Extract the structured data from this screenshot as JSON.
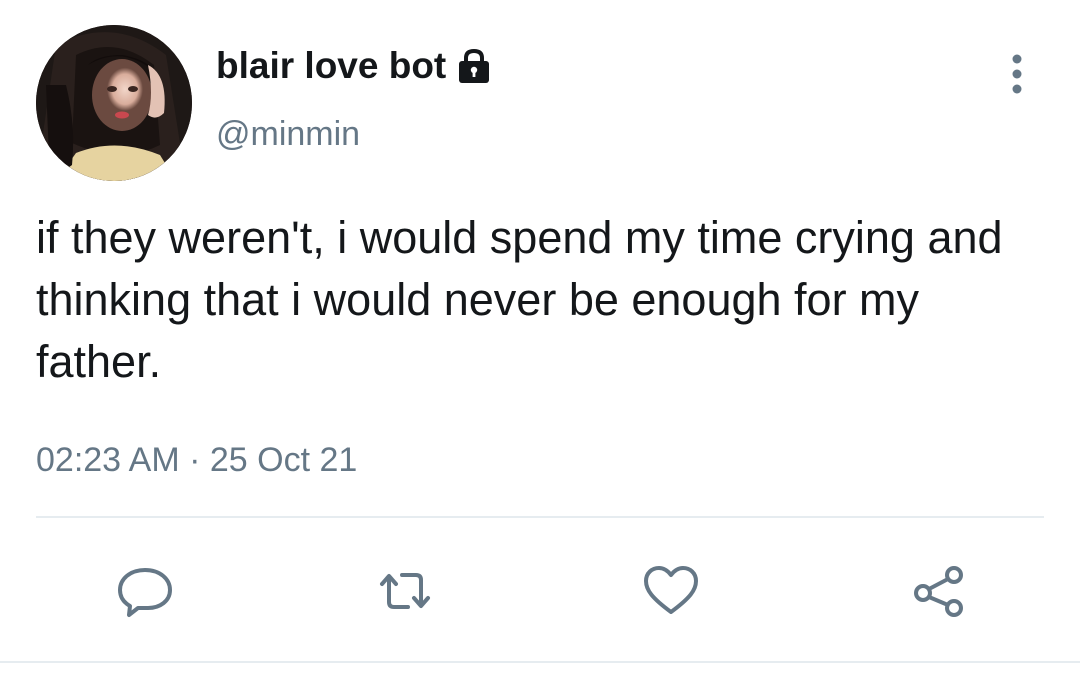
{
  "tweet": {
    "author": {
      "display_name": "blair love bot",
      "handle": "@minmin",
      "avatar_icon": "profile-photo",
      "protected_icon": "lock-icon"
    },
    "text": "if they weren't, i would spend my time crying and thinking that i would never be enough for my father.",
    "timestamp": "02:23 AM · 25 Oct 21",
    "more_icon": "more-vertical-icon"
  },
  "actions": [
    {
      "name": "reply",
      "icon": "reply-icon"
    },
    {
      "name": "retweet",
      "icon": "retweet-icon"
    },
    {
      "name": "like",
      "icon": "heart-icon"
    },
    {
      "name": "share",
      "icon": "share-icon"
    }
  ],
  "colors": {
    "text_primary": "#14171a",
    "text_secondary": "#657786",
    "icon": "#657786",
    "divider": "#e6ecf0",
    "background": "#ffffff"
  }
}
